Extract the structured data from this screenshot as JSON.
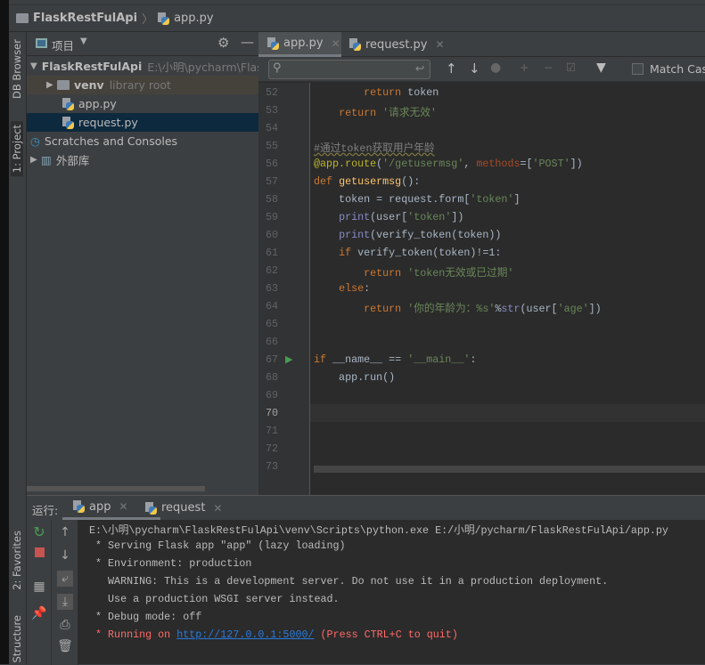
{
  "breadcrumb": {
    "project": "FlaskRestFulApi",
    "file": "app.py"
  },
  "left_strip": {
    "db_browser": "DB Browser",
    "project": "1: Project",
    "favorites": "2: Favorites",
    "structure": "Structure"
  },
  "project_panel": {
    "title": "项目",
    "tree": [
      {
        "label": "FlaskRestFulApi",
        "hint": "E:\\小明\\pycharm\\FlaskRestFulApi",
        "icon": "folder"
      },
      {
        "label": "venv",
        "hint": "library root",
        "icon": "folder"
      },
      {
        "label": "app.py",
        "hint": "",
        "icon": "python-file"
      },
      {
        "label": "request.py",
        "hint": "",
        "icon": "python-file"
      },
      {
        "label": "Scratches and Consoles",
        "hint": "",
        "icon": "scratches"
      },
      {
        "label": "外部库",
        "hint": "",
        "icon": "library"
      }
    ]
  },
  "editor": {
    "tabs": [
      {
        "label": "app.py"
      },
      {
        "label": "request.py"
      }
    ],
    "find": {
      "placeholder": "",
      "match_case": "Match Case"
    },
    "current_line": 70,
    "lines": [
      {
        "n": 52,
        "t": [
          [
            "        ",
            ""
          ],
          [
            "return",
            "kw"
          ],
          [
            " token",
            ""
          ]
        ]
      },
      {
        "n": 53,
        "t": [
          [
            "    ",
            ""
          ],
          [
            "return",
            "kw"
          ],
          [
            " ",
            ""
          ],
          [
            "'请求无效'",
            "str"
          ]
        ]
      },
      {
        "n": 54,
        "t": []
      },
      {
        "n": 55,
        "t": [
          [
            "#通过token获取用户年龄",
            "cm"
          ]
        ]
      },
      {
        "n": 56,
        "t": [
          [
            "@app.route",
            "dec"
          ],
          [
            "(",
            ""
          ],
          [
            "'/getusermsg'",
            "str"
          ],
          [
            ", ",
            ""
          ],
          [
            "methods",
            "par"
          ],
          [
            "=[",
            ""
          ],
          [
            "'POST'",
            "str"
          ],
          [
            "])",
            ""
          ]
        ]
      },
      {
        "n": 57,
        "t": [
          [
            "def",
            "kw"
          ],
          [
            " ",
            ""
          ],
          [
            "getusermsg",
            "fn"
          ],
          [
            "():",
            ""
          ]
        ]
      },
      {
        "n": 58,
        "t": [
          [
            "    token = request.form[",
            ""
          ],
          [
            "'token'",
            "str"
          ],
          [
            "]",
            ""
          ]
        ]
      },
      {
        "n": 59,
        "t": [
          [
            "    ",
            ""
          ],
          [
            "print",
            "bi"
          ],
          [
            "(user[",
            ""
          ],
          [
            "'token'",
            "str"
          ],
          [
            "])",
            ""
          ]
        ]
      },
      {
        "n": 60,
        "t": [
          [
            "    ",
            ""
          ],
          [
            "print",
            "bi"
          ],
          [
            "(verify_token(token))",
            ""
          ]
        ]
      },
      {
        "n": 61,
        "t": [
          [
            "    ",
            ""
          ],
          [
            "if",
            "kw"
          ],
          [
            " verify_token(token)!=1:",
            ""
          ]
        ]
      },
      {
        "n": 62,
        "t": [
          [
            "        ",
            ""
          ],
          [
            "return",
            "kw"
          ],
          [
            " ",
            ""
          ],
          [
            "'token无效或已过期'",
            "str"
          ]
        ]
      },
      {
        "n": 63,
        "t": [
          [
            "    ",
            ""
          ],
          [
            "else",
            "kw"
          ],
          [
            ":",
            ""
          ]
        ]
      },
      {
        "n": 64,
        "t": [
          [
            "        ",
            ""
          ],
          [
            "return",
            "kw"
          ],
          [
            " ",
            ""
          ],
          [
            "'你的年龄为：%s'",
            "str"
          ],
          [
            "%",
            ""
          ],
          [
            "str",
            "bi"
          ],
          [
            "(user[",
            ""
          ],
          [
            "'age'",
            "str"
          ],
          [
            "])",
            ""
          ]
        ]
      },
      {
        "n": 65,
        "t": []
      },
      {
        "n": 66,
        "t": []
      },
      {
        "n": 67,
        "t": [
          [
            "if",
            "kw"
          ],
          [
            " __name__ == ",
            ""
          ],
          [
            "'__main__'",
            "str"
          ],
          [
            ":",
            ""
          ]
        ]
      },
      {
        "n": 68,
        "t": [
          [
            "    app.run()",
            ""
          ]
        ]
      },
      {
        "n": 69,
        "t": []
      },
      {
        "n": 70,
        "t": []
      },
      {
        "n": 71,
        "t": []
      },
      {
        "n": 72,
        "t": []
      },
      {
        "n": 73,
        "t": []
      }
    ]
  },
  "run": {
    "label": "运行:",
    "tabs": [
      {
        "label": "app"
      },
      {
        "label": "request"
      }
    ],
    "console": [
      {
        "text": "E:\\小明\\pycharm\\FlaskRestFulApi\\venv\\Scripts\\python.exe E:/小明/pycharm/FlaskRestFulApi/app.py"
      },
      {
        "text": " * Serving Flask app \"app\" (lazy loading)"
      },
      {
        "text": " * Environment: production"
      },
      {
        "text": "   WARNING: This is a development server. Do not use it in a production deployment."
      },
      {
        "text": "   Use a production WSGI server instead."
      },
      {
        "text": " * Debug mode: off"
      }
    ],
    "running": {
      "prefix": " * Running on ",
      "url": "http://127.0.0.1:5000/",
      "suffix": " (Press CTRL+C to quit)"
    }
  }
}
